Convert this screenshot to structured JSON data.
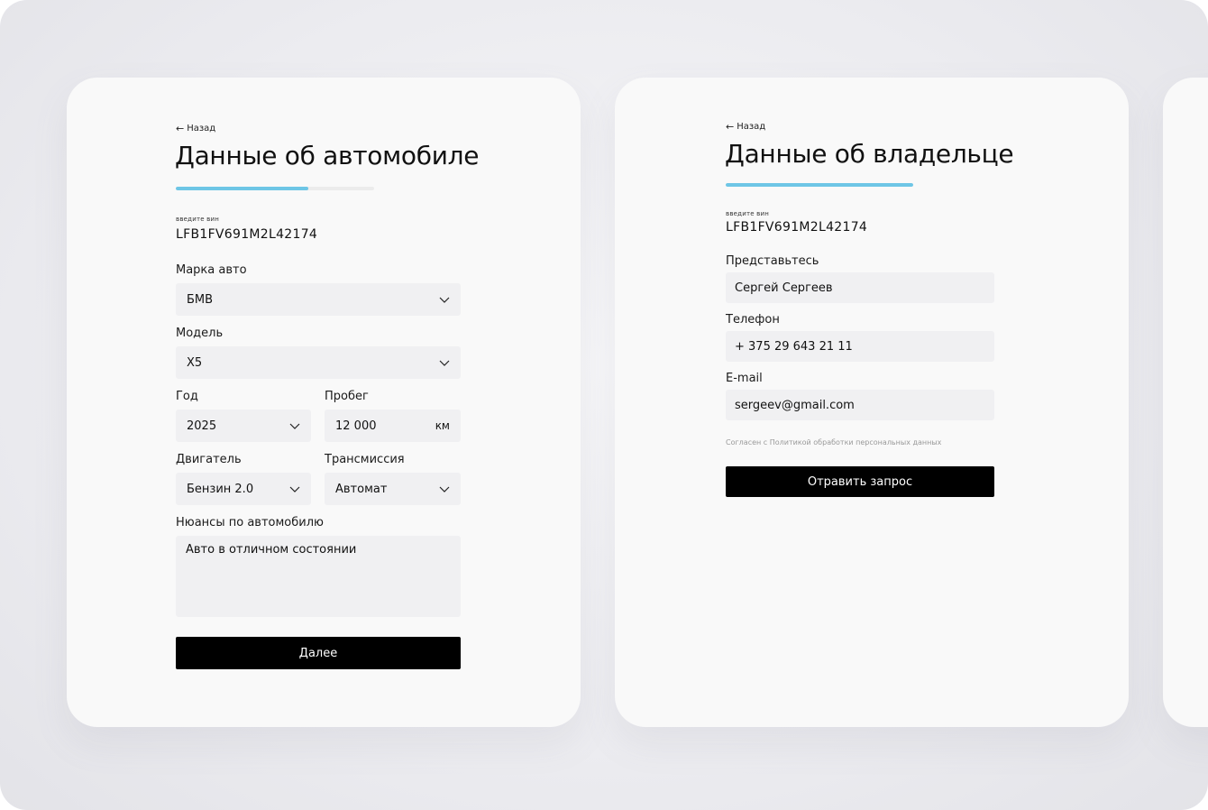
{
  "car_form": {
    "back_label": "Назад",
    "title": "Данные об автомобиле",
    "progress": 0.67,
    "vin_label": "введите вин",
    "vin_value": "LFB1FV691M2L42174",
    "brand": {
      "label": "Марка авто",
      "value": "БМВ"
    },
    "model": {
      "label": "Модель",
      "value": "X5"
    },
    "year": {
      "label": "Год",
      "value": "2025"
    },
    "mileage": {
      "label": "Пробег",
      "value": "12 000",
      "unit": "км"
    },
    "engine": {
      "label": "Двигатель",
      "value": "Бензин 2.0"
    },
    "transmission": {
      "label": "Трансмиссия",
      "value": "Автомат"
    },
    "notes": {
      "label": "Нюансы по автомобилю",
      "value": "Авто в отличном состоянии"
    },
    "next_button": "Далее"
  },
  "owner_form": {
    "back_label": "Назад",
    "title": "Данные об владельце",
    "progress": 1.0,
    "vin_label": "введите вин",
    "vin_value": "LFB1FV691M2L42174",
    "name": {
      "label": "Представьтесь",
      "value": "Сергей Сергеев"
    },
    "phone": {
      "label": "Телефон",
      "value": "+ 375 29 643 21 11"
    },
    "email": {
      "label": "E-mail",
      "value": "sergeev@gmail.com"
    },
    "consent": "Согласен с Политикой обработки персональных данных",
    "submit_button": "Отравить запрос"
  },
  "colors": {
    "accent": "#6ec6e6",
    "button": "#000000",
    "field_bg": "#f0f0f2",
    "card_bg": "#f9f9f9"
  },
  "icons": {
    "back": "arrow-left-icon",
    "dropdown": "chevron-down-icon"
  }
}
